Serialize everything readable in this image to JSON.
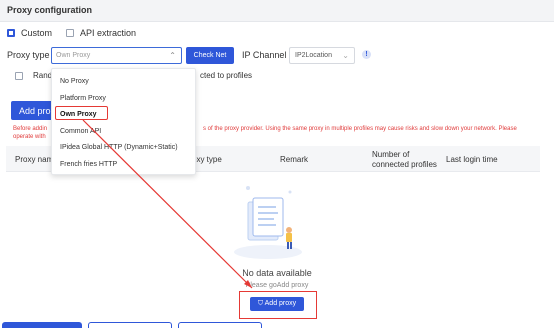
{
  "header": {
    "title": "Proxy configuration"
  },
  "mode": {
    "custom_label": "Custom",
    "api_label": "API extraction"
  },
  "proxy_type": {
    "label": "Proxy type",
    "value": "Own Proxy"
  },
  "check_net_label": "Check Net",
  "ip_channel": {
    "label": "IP Channel",
    "value": "IP2Location"
  },
  "random": {
    "label_start": "Rand",
    "label_end": "cted to profiles"
  },
  "add_proxy_top_label": "Add pro",
  "warning": {
    "line1_start": "Before addin",
    "line1_end": "s of the proxy provider. Using the same proxy in multiple profiles may cause risks and slow down your network. Please",
    "line2": "operate with"
  },
  "table": {
    "col_name": "Proxy nam",
    "col_type": "oxy type",
    "col_remark": "Remark",
    "col_connected_1": "Number of",
    "col_connected_2": "connected profiles",
    "col_login": "Last login time"
  },
  "empty": {
    "title": "No data available",
    "hint": "Please goAdd proxy",
    "button_label": "Add proxy",
    "button_icon": "⛉"
  },
  "dropdown": {
    "options": [
      "No Proxy",
      "Platform Proxy",
      "Own Proxy",
      "Common API",
      "IPidea Global HTTP (Dynamic+Static)",
      "French fries HTTP"
    ]
  },
  "colors": {
    "accent": "#2f57d9",
    "highlight": "#e53935",
    "warning": "#e03b3b"
  }
}
